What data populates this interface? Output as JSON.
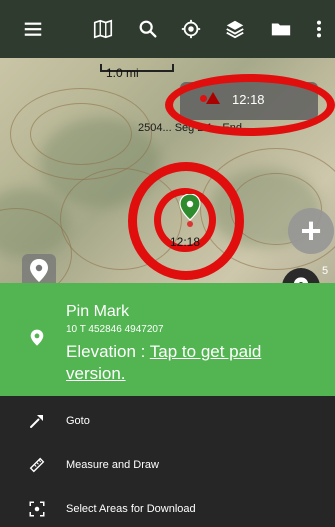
{
  "toolbar": {
    "icons": [
      "menu-icon",
      "map-icon",
      "search-icon",
      "gps-icon",
      "layers-icon",
      "folder-icon",
      "more-icon"
    ]
  },
  "map": {
    "scale_label": "1.0 mi",
    "track_time": "12:18",
    "track_label": "2504... Seg 2.1 - End",
    "pin_time": "12:18",
    "edge_number": "5"
  },
  "info": {
    "title": "Pin Mark",
    "coords": "10 T 452846 4947207",
    "elevation_label": "Elevation : ",
    "elevation_link": "Tap to get paid version."
  },
  "actions": [
    {
      "label": "Goto",
      "icon": "goto-icon"
    },
    {
      "label": "Measure and Draw",
      "icon": "ruler-icon"
    },
    {
      "label": "Select Areas for Download",
      "icon": "select-area-icon"
    }
  ],
  "colors": {
    "toolbar": "#2f3b2f",
    "info_panel": "#52b552",
    "action_list": "#262626",
    "highlight_ring": "#e10e0e",
    "pin": "#2e8b2e"
  }
}
